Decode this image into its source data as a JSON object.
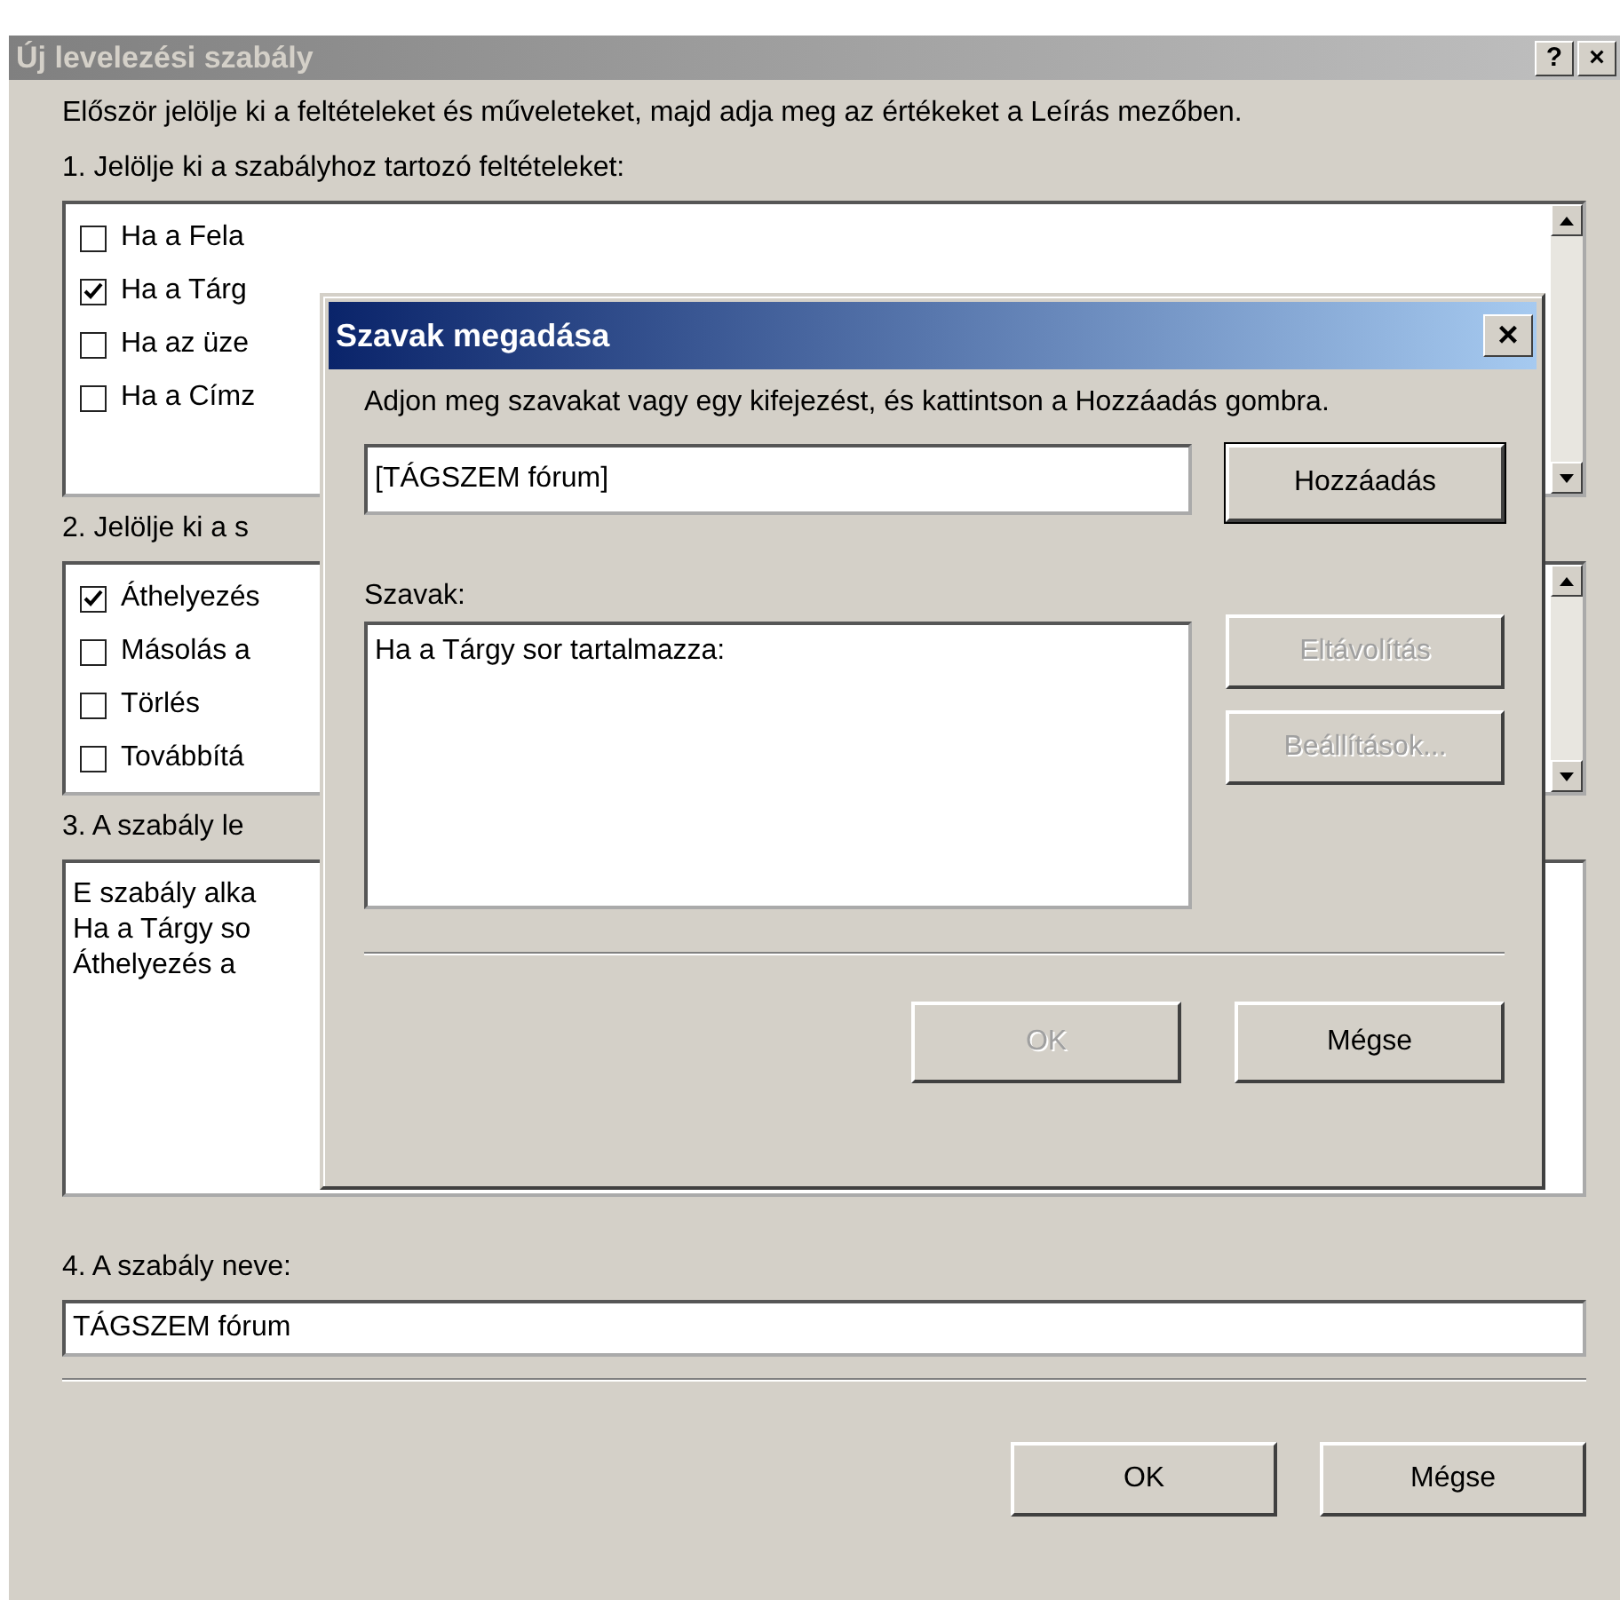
{
  "window": {
    "title": "Új levelezési szabály",
    "active": false,
    "buttons": [
      "?",
      "×"
    ]
  },
  "intro": "Először jelölje ki a feltételeket és műveleteket, majd adja meg az értékeket a Leírás mezőben.",
  "conditions": {
    "label": "1. Jelölje ki a szabályhoz tartozó feltételeket:",
    "items": [
      {
        "label": "Ha a Fela",
        "checked": false
      },
      {
        "label": "Ha a Tárg",
        "checked": true
      },
      {
        "label": "Ha az üze",
        "checked": false
      },
      {
        "label": "Ha a Címz",
        "checked": false
      }
    ]
  },
  "actions": {
    "label": "2. Jelölje ki a s",
    "items": [
      {
        "label": "Áthelyezés",
        "checked": true
      },
      {
        "label": "Másolás a",
        "checked": false
      },
      {
        "label": "Törlés",
        "checked": false
      },
      {
        "label": "Továbbítá",
        "checked": false
      }
    ]
  },
  "description": {
    "label": "3. A szabály le",
    "lines": [
      "E szabály alka",
      "Ha a Tárgy so",
      "Áthelyezés a"
    ]
  },
  "rule_name": {
    "label": "4. A szabály neve:",
    "value": "TÁGSZEM fórum"
  },
  "buttons": [
    {
      "label": "OK",
      "disabled": false
    },
    {
      "label": "Mégse",
      "disabled": false
    }
  ],
  "dialog": {
    "title": "Szavak megadása",
    "active": true,
    "close": "×",
    "instruction": "Adjon meg szavakat vagy egy kifejezést, és kattintson a Hozzáadás gombra.",
    "input": {
      "value": "[TÁGSZEM fórum]"
    },
    "add_button": {
      "label": "Hozzáadás",
      "disabled": false
    },
    "words_label": "Szavak:",
    "words": [
      "Ha a Tárgy sor tartalmazza:"
    ],
    "side_buttons": [
      {
        "label": "Eltávolítás",
        "disabled": true
      },
      {
        "label": "Beállítások...",
        "disabled": true
      }
    ],
    "buttons": [
      {
        "label": "OK",
        "disabled": true
      },
      {
        "label": "Mégse",
        "disabled": false
      }
    ]
  }
}
